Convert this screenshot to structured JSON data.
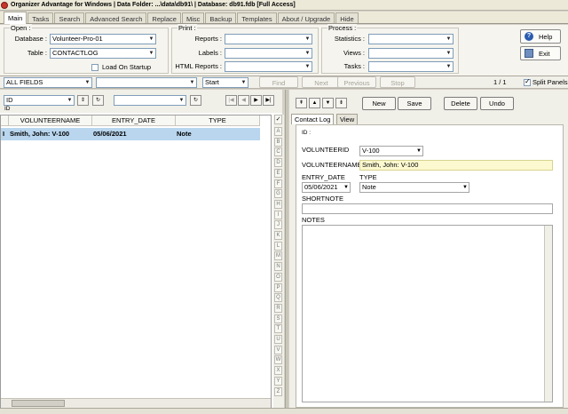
{
  "window": {
    "title": "Organizer Advantage for Windows | Data Folder: ...\\data\\db91\\ | Database: db91.fdb [Full Access]"
  },
  "main_tabs": [
    "Main",
    "Tasks",
    "Search",
    "Advanced Search",
    "Replace",
    "Misc",
    "Backup",
    "Templates",
    "About / Upgrade",
    "Hide"
  ],
  "ribbon": {
    "open": {
      "group_title": "Open :",
      "database_label": "Database :",
      "database_value": "Volunteer-Pro-01",
      "table_label": "Table :",
      "table_value": "CONTACTLOG",
      "load_on_startup_label": "Load On Startup"
    },
    "print": {
      "group_title": "Print :",
      "reports_label": "Reports :",
      "labels_label": "Labels :",
      "html_reports_label": "HTML Reports :"
    },
    "process": {
      "group_title": "Process :",
      "statistics_label": "Statistics :",
      "views_label": "Views :",
      "tasks_label": "Tasks :"
    },
    "help_label": "Help",
    "exit_label": "Exit"
  },
  "search_bar": {
    "field_value": "ALL FIELDS",
    "search_value": "",
    "mode_value": "Start",
    "find_label": "Find",
    "next_label": "Next",
    "previous_label": "Previous",
    "stop_label": "Stop",
    "record_counter": "1 / 1",
    "split_panels_label": "Split Panels"
  },
  "left_panel": {
    "sort_field_value": "ID",
    "sort_field_sub": "ID",
    "filter_value": "",
    "columns": [
      "VOLUNTEERNAME",
      "ENTRY_DATE",
      "TYPE"
    ],
    "rows": [
      {
        "marker": "I",
        "volunteername": "Smith, John: V-100",
        "entry_date": "05/06/2021",
        "type": "Note"
      }
    ],
    "alphabet": [
      "A",
      "B",
      "C",
      "D",
      "E",
      "F",
      "G",
      "H",
      "I",
      "J",
      "K",
      "L",
      "M",
      "N",
      "O",
      "P",
      "Q",
      "R",
      "S",
      "T",
      "U",
      "V",
      "W",
      "X",
      "Y",
      "Z"
    ]
  },
  "right_panel": {
    "buttons": {
      "new": "New",
      "save": "Save",
      "delete": "Delete",
      "undo": "Undo"
    },
    "subtabs": [
      "Contact Log",
      "View"
    ],
    "form": {
      "id_label": "ID :",
      "volunteerid_label": "VOLUNTEERID",
      "volunteerid_value": "V-100",
      "volunteername_label": "VOLUNTEERNAME",
      "volunteername_value": "Smith, John: V-100",
      "entry_date_label": "ENTRY_DATE",
      "entry_date_value": "05/06/2021",
      "type_label": "TYPE",
      "type_value": "Note",
      "shortnote_label": "SHORTNOTE",
      "shortnote_value": "",
      "notes_label": "NOTES",
      "notes_value": ""
    }
  }
}
